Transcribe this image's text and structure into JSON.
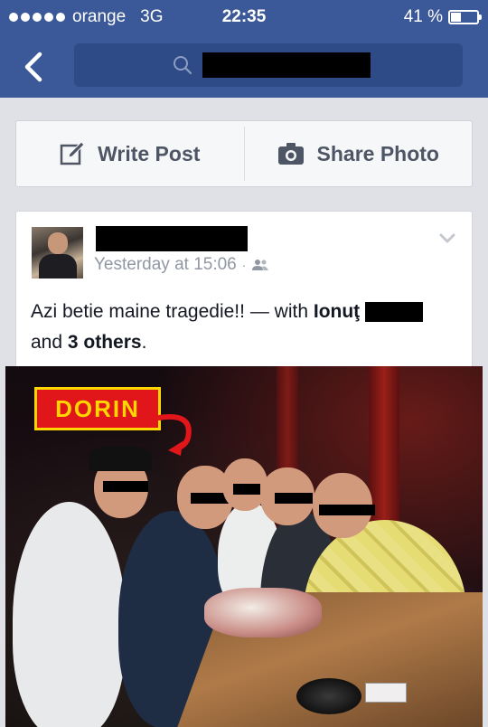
{
  "status_bar": {
    "carrier": "orange",
    "network": "3G",
    "time": "22:35",
    "battery_percent_text": "41 %",
    "battery_level": 0.41
  },
  "nav": {
    "back_icon": "chevron-left-icon",
    "search_icon": "search-icon"
  },
  "composer": {
    "write_post_label": "Write Post",
    "share_photo_label": "Share Photo"
  },
  "post": {
    "timestamp": "Yesterday at 15:06",
    "separator": "·",
    "audience_icon": "friends-icon",
    "text_main": "Azi betie maine tragedie!!",
    "dash": "—",
    "with_word": "with",
    "tagged_first": "Ionuţ",
    "and_word": "and",
    "others": "3 others",
    "period": "."
  },
  "photo": {
    "caption_label": "DORIN"
  },
  "colors": {
    "facebook_blue": "#3b5998",
    "search_bg": "#2f4b87",
    "label_red": "#e0161b",
    "label_yellow": "#ffd700"
  }
}
